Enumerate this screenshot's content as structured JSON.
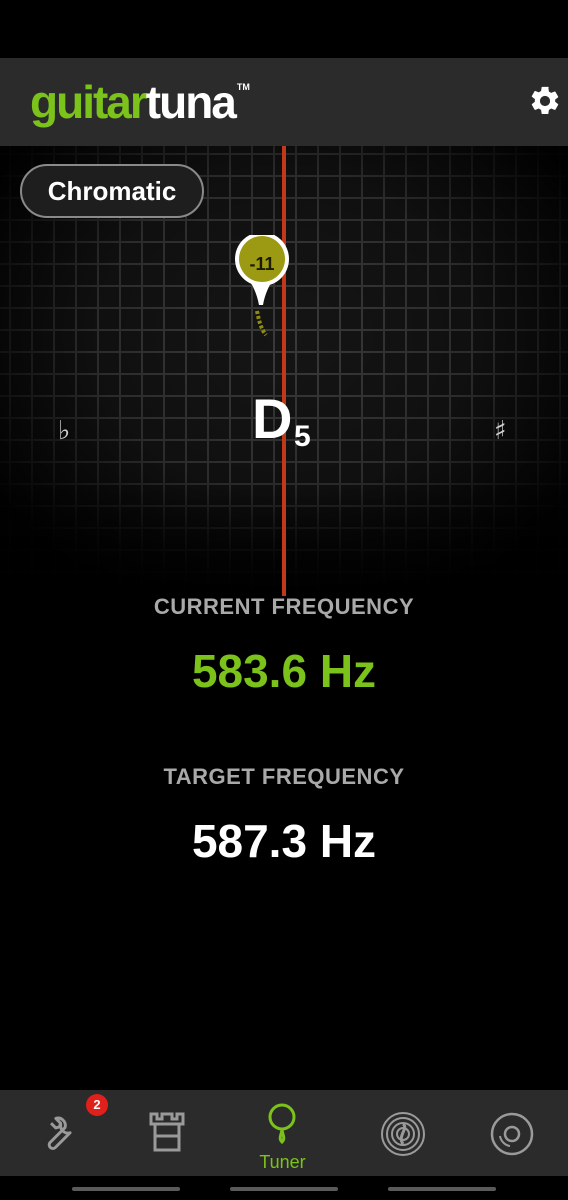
{
  "app": {
    "logo_brand_1": "guitar",
    "logo_brand_2": "tuna",
    "logo_trademark": "TM"
  },
  "tuner": {
    "mode_label": "Chromatic",
    "cents_offset": "-11",
    "note": "D",
    "octave": "5",
    "flat_symbol": "♭",
    "sharp_symbol": "♯"
  },
  "readout": {
    "current_label": "CURRENT FREQUENCY",
    "current_value": "583.6 Hz",
    "target_label": "TARGET FREQUENCY",
    "target_value": "587.3 Hz"
  },
  "nav": {
    "items": [
      {
        "icon": "wrench-icon",
        "badge": "2"
      },
      {
        "icon": "tower-icon"
      },
      {
        "icon": "tuner-icon",
        "label": "Tuner",
        "selected": true
      },
      {
        "icon": "fingerprint-icon"
      },
      {
        "icon": "disc-icon"
      }
    ]
  },
  "colors": {
    "accent": "#7bc21b",
    "center_line": "#c2381a",
    "pin": "#9c9a12",
    "badge": "#e0201a"
  }
}
